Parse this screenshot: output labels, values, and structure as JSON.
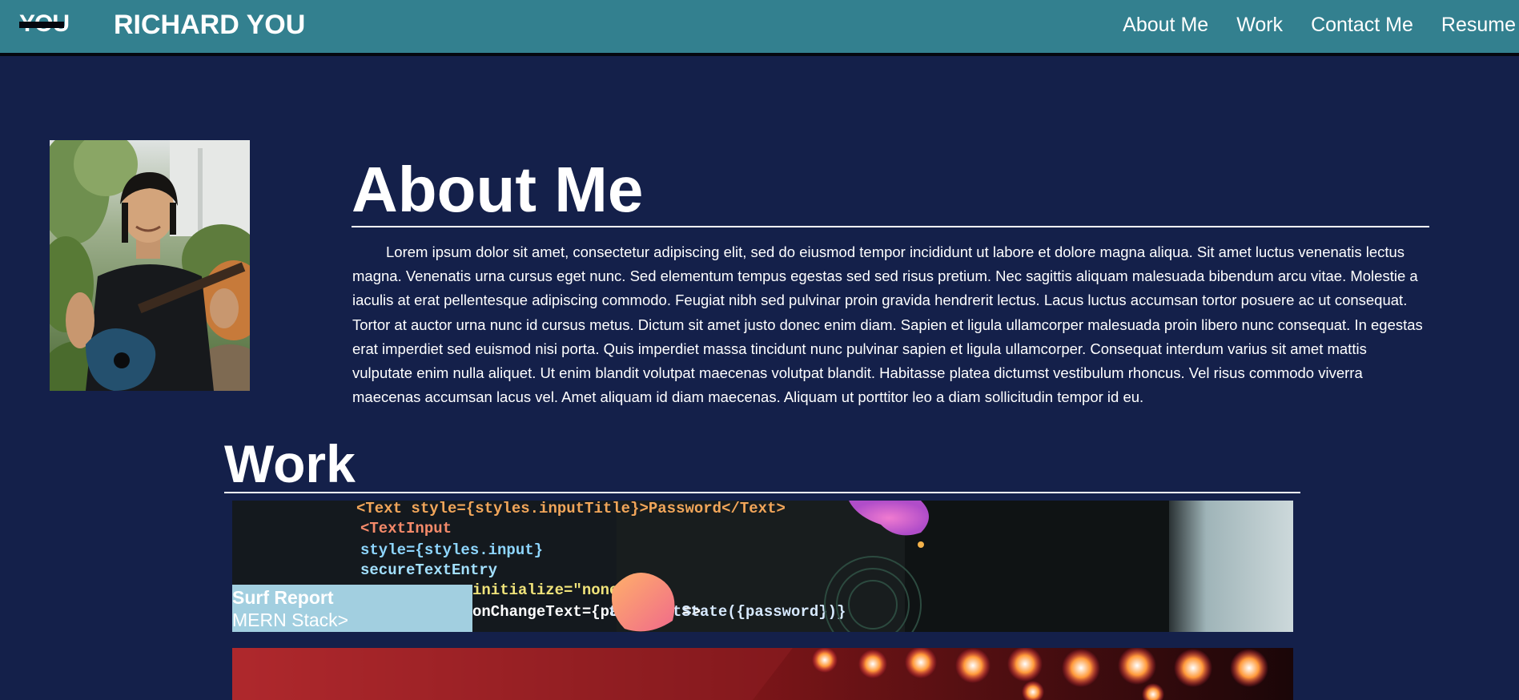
{
  "header": {
    "logo_text": "YOU",
    "brand_name": "RICHARD YOU",
    "nav": [
      {
        "label": "About Me"
      },
      {
        "label": "Work"
      },
      {
        "label": "Contact Me"
      },
      {
        "label": "Resume"
      }
    ]
  },
  "about": {
    "title": "About Me",
    "photo_icon": "profile-photo",
    "body": "Lorem ipsum dolor sit amet, consectetur adipiscing elit, sed do eiusmod tempor incididunt ut labore et dolore magna aliqua. Sit amet luctus venenatis lectus magna. Venenatis urna cursus eget nunc. Sed elementum tempus egestas sed sed risus pretium. Nec sagittis aliquam malesuada bibendum arcu vitae. Molestie a iaculis at erat pellentesque adipiscing commodo. Feugiat nibh sed pulvinar proin gravida hendrerit lectus. Lacus luctus accumsan tortor posuere ac ut consequat. Tortor at auctor urna nunc id cursus metus. Dictum sit amet justo donec enim diam. Sapien et ligula ullamcorper malesuada proin libero nunc consequat. In egestas erat imperdiet sed euismod nisi porta. Quis imperdiet massa tincidunt nunc pulvinar sapien et ligula ullamcorper. Consequat interdum varius sit amet mattis vulputate enim nulla aliquet. Ut enim blandit volutpat maecenas volutpat blandit. Habitasse platea dictumst vestibulum rhoncus. Vel risus commodo viverra maecenas accumsan lacus vel. Amet aliquam id diam maecenas. Aliquam ut porttitor leo a diam sollicitudin tempor id eu."
  },
  "work": {
    "title": "Work",
    "projects": [
      {
        "name": "Surf Report",
        "tech": "MERN Stack>",
        "code_lines": [
          "<Text style={styles.inputTitle}>Password</Text>",
          "<TextInput",
          "  style={styles.input}",
          "  secureTextEntry",
          "  initialize=\"none\"",
          "  onChangeText={password =>",
          "    this.setState({password})}"
        ]
      }
    ]
  },
  "colors": {
    "header_bg": "#33808f",
    "page_bg": "#14204a",
    "label_bg": "#a2cfe0"
  }
}
